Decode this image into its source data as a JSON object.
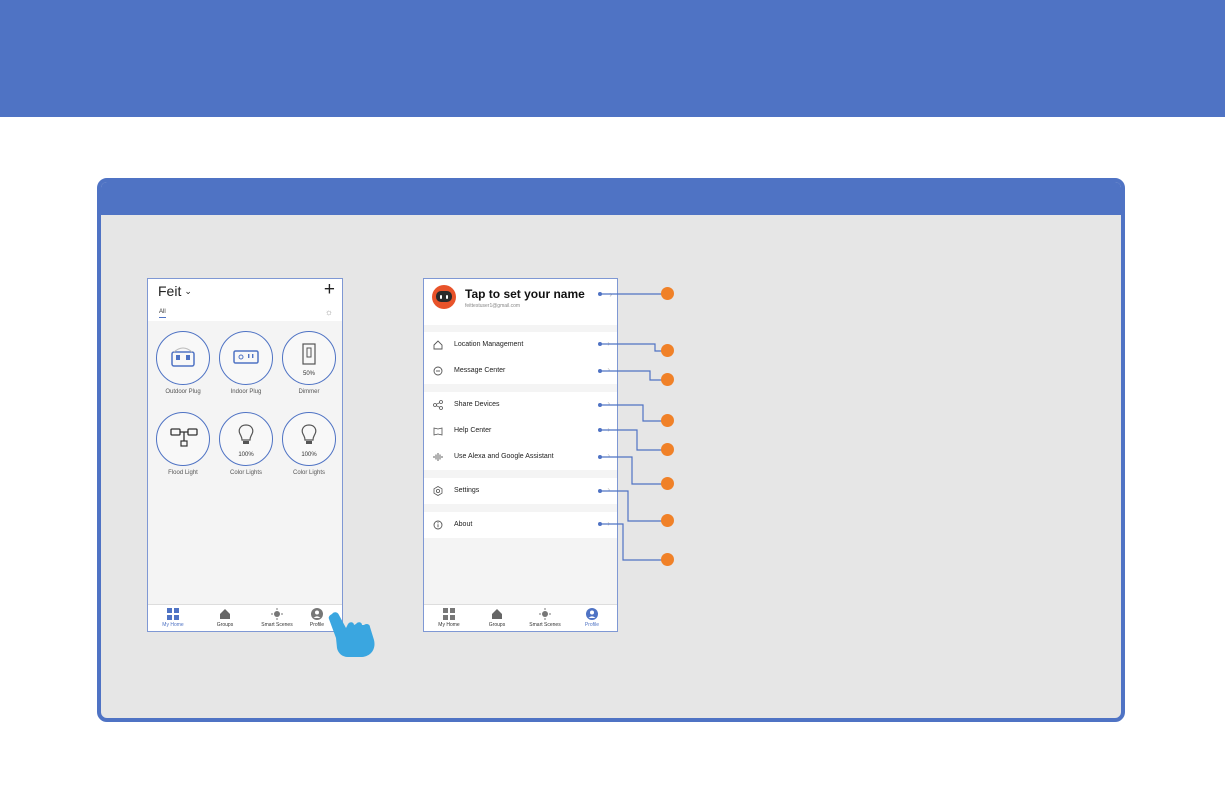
{
  "phone1": {
    "home_title": "Feit",
    "tab_all": "All",
    "devices": [
      {
        "name": "Outdoor Plug",
        "icon": "outdoor-plug-icon",
        "percent": ""
      },
      {
        "name": "Indoor Plug",
        "icon": "indoor-plug-icon",
        "percent": ""
      },
      {
        "name": "Dimmer",
        "icon": "dimmer-icon",
        "percent": "50%"
      },
      {
        "name": "Flood Light",
        "icon": "flood-light-icon",
        "percent": ""
      },
      {
        "name": "Color Lights",
        "icon": "bulb-icon",
        "percent": "100%"
      },
      {
        "name": "Color Lights",
        "icon": "bulb-icon",
        "percent": "100%"
      }
    ]
  },
  "tabbar": {
    "my_home": "My Home",
    "groups": "Groups",
    "smart_scenes": "Smart Scenes",
    "profile": "Profile"
  },
  "phone2": {
    "user_name": "Tap to set your name",
    "email": "feittestuser1@gmail.com",
    "menu": [
      {
        "label": "Location Management",
        "icon": "home-outline-icon"
      },
      {
        "label": "Message Center",
        "icon": "message-icon"
      },
      {
        "label": "Share Devices",
        "icon": "share-icon"
      },
      {
        "label": "Help Center",
        "icon": "book-icon"
      },
      {
        "label": "Use Alexa and Google Assistant",
        "icon": "voice-icon"
      },
      {
        "label": "Settings",
        "icon": "settings-icon"
      },
      {
        "label": "About",
        "icon": "info-icon"
      }
    ]
  },
  "colors": {
    "brand_blue": "#4f73c4",
    "callout_orange": "#f08128",
    "panel_bg": "#e6e6e6"
  }
}
